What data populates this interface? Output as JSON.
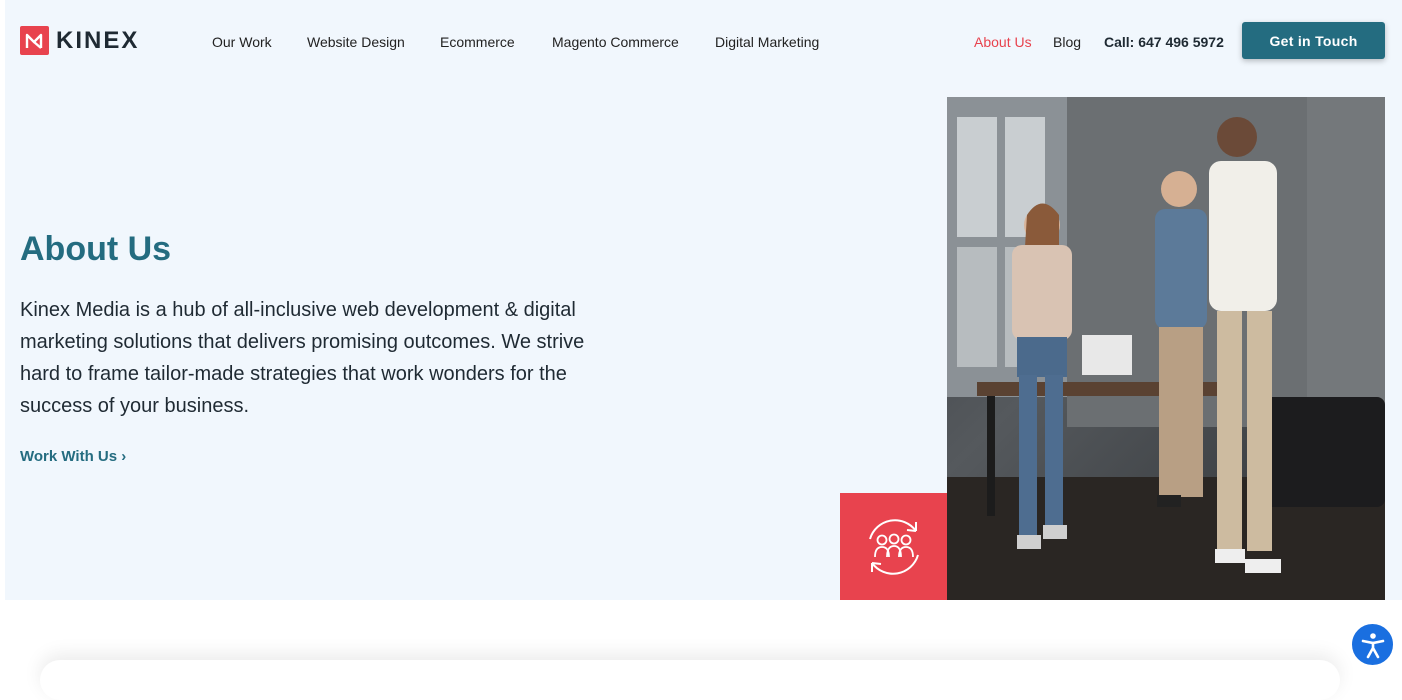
{
  "brand": {
    "name": "KINEX"
  },
  "nav": {
    "our_work": "Our Work",
    "website_design": "Website Design",
    "ecommerce": "Ecommerce",
    "magento": "Magento Commerce",
    "digital_marketing": "Digital Marketing",
    "about_us": "About Us",
    "blog": "Blog"
  },
  "header": {
    "call": "Call: 647 496 5972",
    "cta": "Get in Touch"
  },
  "hero": {
    "title": "About Us",
    "body": "Kinex Media is a hub of all-inclusive web development & digital marketing solutions that delivers promising outcomes. We strive hard to frame tailor-made strategies that work wonders for the success of your business.",
    "link": "Work With Us ›"
  },
  "icons": {
    "team": "team-cycle-icon",
    "accessibility": "accessibility-icon"
  },
  "colors": {
    "brand_red": "#e8434e",
    "brand_teal": "#246c80",
    "hero_bg": "#f1f7fd",
    "a11y_blue": "#1a6fe0"
  }
}
